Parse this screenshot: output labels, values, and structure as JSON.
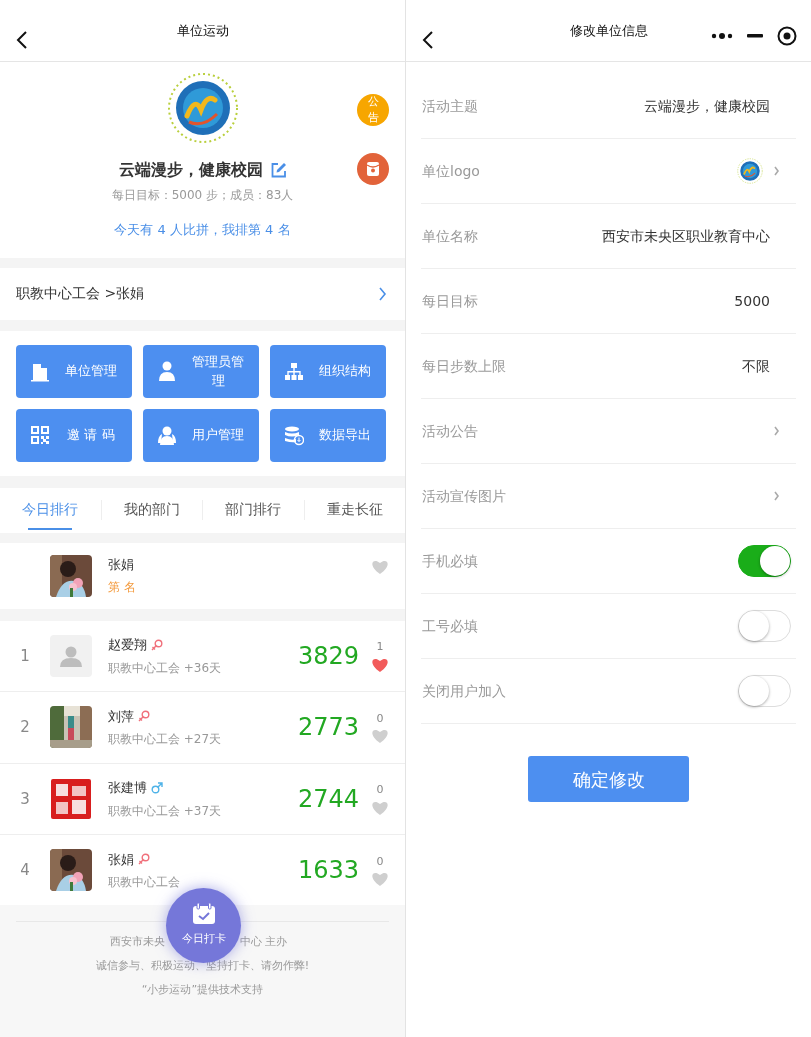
{
  "left": {
    "nav": {
      "title": "单位运动"
    },
    "header": {
      "title": "云端漫步，健康校园",
      "stats": "每日目标：5000 步；成员：83人",
      "summary": "今天有 4 人比拼，我排第 4 名"
    },
    "side_buttons": [
      {
        "kind": "notice",
        "label": "公告"
      },
      {
        "kind": "redpacket"
      }
    ],
    "breadcrumb": "职教中心工会 >张娟",
    "actions": [
      {
        "kind": "building",
        "label": "单位管理"
      },
      {
        "kind": "admin",
        "label": "管理员管理"
      },
      {
        "kind": "org",
        "label": "组织结构"
      },
      {
        "kind": "qr",
        "label": "邀 请 码"
      },
      {
        "kind": "users",
        "label": "用户管理"
      },
      {
        "kind": "export",
        "label": "数据导出"
      }
    ],
    "tabs": [
      {
        "label": "今日排行",
        "selected": true
      },
      {
        "label": "我的部门",
        "selected": false
      },
      {
        "label": "部门排行",
        "selected": false
      },
      {
        "label": "重走长征",
        "selected": false
      }
    ],
    "me": {
      "name": "张娟",
      "rank": "第 名",
      "liked": false
    },
    "rankings": [
      {
        "rank": "1",
        "name": "赵爱翔",
        "kind": "female",
        "dept": "职教中心工会 +36天",
        "steps": "3829",
        "likes": "1",
        "liked": true,
        "avatar": {
          "kind": "default"
        }
      },
      {
        "rank": "2",
        "name": "刘萍",
        "kind": "female",
        "dept": "职教中心工会 +27天",
        "steps": "2773",
        "likes": "0",
        "liked": false
      },
      {
        "rank": "3",
        "name": "张建博",
        "kind": "male",
        "dept": "职教中心工会 +37天",
        "steps": "2744",
        "likes": "0",
        "liked": false
      },
      {
        "rank": "4",
        "name": "张娟",
        "kind": "female",
        "dept": "职教中心工会",
        "steps": "1633",
        "likes": "0",
        "liked": false
      }
    ],
    "checkin": {
      "label": "今日打卡"
    },
    "footer": [
      [
        "西安市未央",
        "中心 主办"
      ],
      "诚信参与、积极运动、坚持打卡、请勿作弊!",
      "“小步运动”提供技术支持"
    ]
  },
  "right": {
    "nav": {
      "title": "修改单位信息"
    },
    "rows": [
      {
        "kind": "text",
        "label": "活动主题",
        "value": "云端漫步，健康校园"
      },
      {
        "kind": "logo",
        "label": "单位logo"
      },
      {
        "kind": "text",
        "label": "单位名称",
        "value": "西安市未央区职业教育中心"
      },
      {
        "kind": "text",
        "label": "每日目标",
        "value": "5000"
      },
      {
        "kind": "text",
        "label": "每日步数上限",
        "value": "不限"
      },
      {
        "kind": "link",
        "label": "活动公告"
      },
      {
        "kind": "link",
        "label": "活动宣传图片"
      },
      {
        "kind": "toggle",
        "label": "手机必填",
        "on": true
      },
      {
        "kind": "toggle",
        "label": "工号必填",
        "on": false
      },
      {
        "kind": "toggle",
        "label": "关闭用户加入",
        "on": false
      }
    ],
    "submit": "确定修改"
  }
}
